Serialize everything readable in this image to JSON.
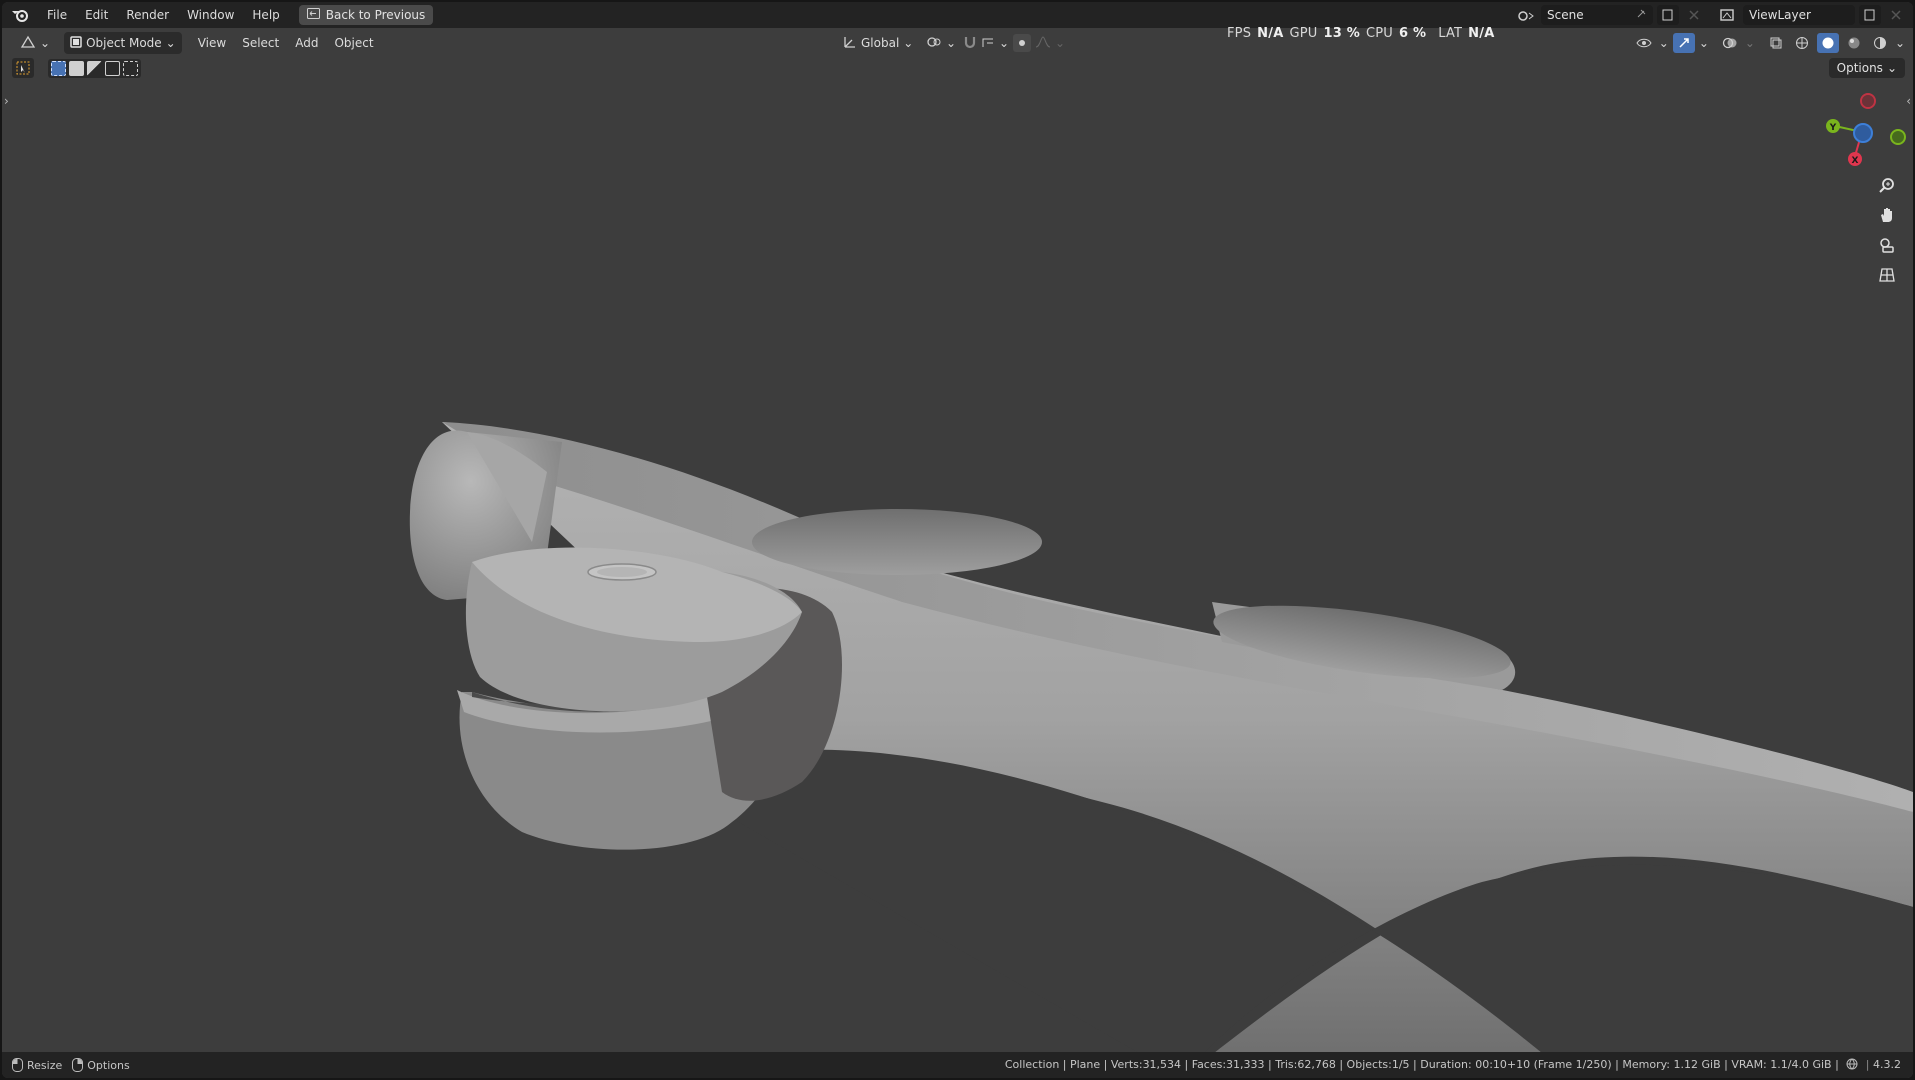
{
  "menu": {
    "items": [
      "File",
      "Edit",
      "Render",
      "Window",
      "Help"
    ],
    "back_button": "Back to Previous"
  },
  "workspace": {
    "scene_label": "Scene",
    "view_layer_label": "ViewLayer"
  },
  "header": {
    "mode": "Object Mode",
    "menus": [
      "View",
      "Select",
      "Add",
      "Object"
    ],
    "transform_orientation": "Global",
    "options_label": "Options"
  },
  "stats": {
    "fps_label": "FPS",
    "fps_value": "N/A",
    "gpu_label": "GPU",
    "gpu_value": "13 %",
    "cpu_label": "CPU",
    "cpu_value": "6 %",
    "lat_label": "LAT",
    "lat_value": "N/A"
  },
  "gizmo": {
    "x_label": "X",
    "y_label": "Y"
  },
  "status": {
    "resize_label": "Resize",
    "options_label": "Options",
    "info": "Collection | Plane | Verts:31,534 | Faces:31,333 | Tris:62,768 | Objects:1/5 | Duration: 00:10+10 (Frame 1/250) | Memory: 1.12 GiB | VRAM: 1.1/4.0 GiB |",
    "version": "4.3.2"
  },
  "colors": {
    "accent_blue": "#4772b3",
    "axis_x": "#e0364e",
    "axis_y": "#7ab51d",
    "axis_z": "#3d7fd8"
  }
}
